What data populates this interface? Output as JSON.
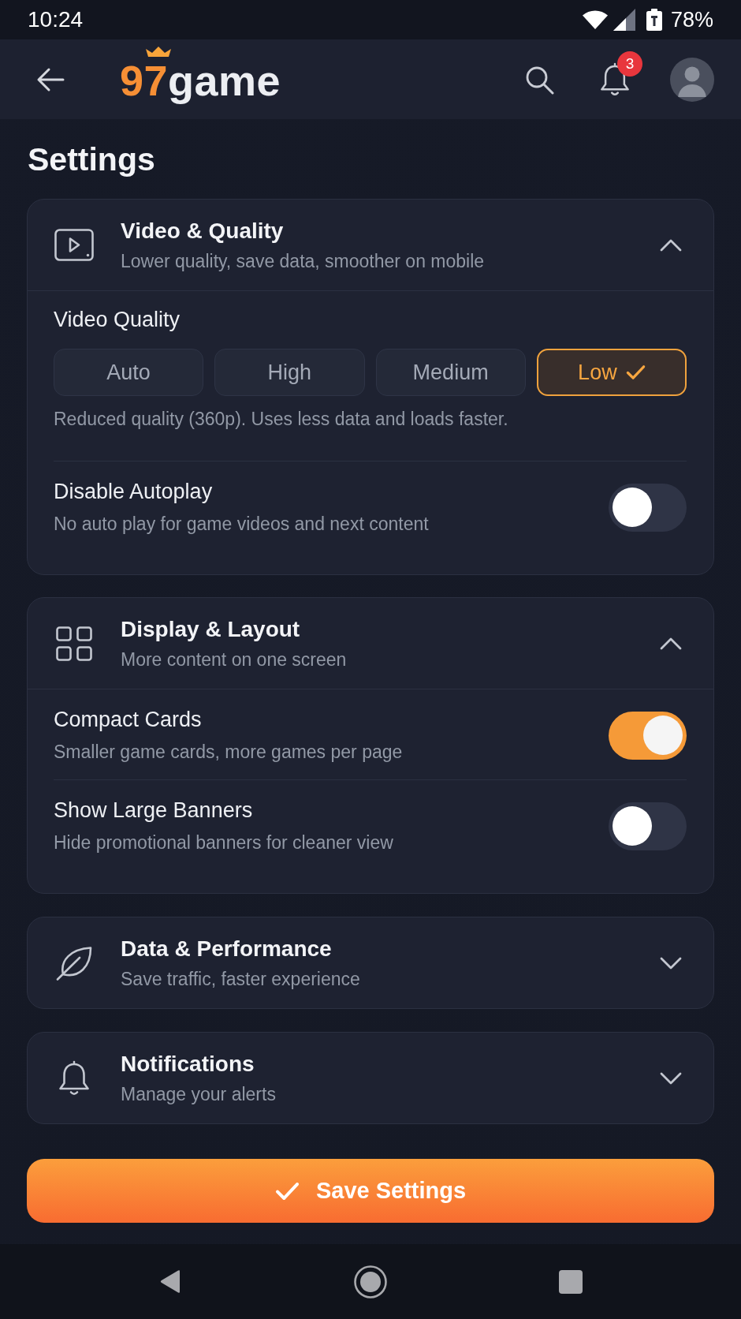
{
  "status_bar": {
    "time": "10:24",
    "battery": "78%"
  },
  "app_bar": {
    "logo": {
      "accent": "97",
      "text": "game"
    },
    "notification_count": "3"
  },
  "page_title": "Settings",
  "sections": [
    {
      "title": "Video & Quality",
      "subtitle": "Lower quality, save data, smoother on mobile",
      "expanded": true,
      "items": [
        {
          "kind": "choice",
          "label": "Video Quality",
          "options": [
            {
              "label": "Auto",
              "selected": false
            },
            {
              "label": "High",
              "selected": false
            },
            {
              "label": "Medium",
              "selected": false
            },
            {
              "label": "Low",
              "selected": true
            }
          ],
          "note": "Reduced quality (360p). Uses less data and loads faster."
        },
        {
          "kind": "toggle",
          "label": "Disable Autoplay",
          "description": "No auto play for game videos and next content",
          "on": false
        }
      ]
    },
    {
      "title": "Display & Layout",
      "subtitle": "More content on one screen",
      "expanded": true,
      "items": [
        {
          "kind": "toggle",
          "label": "Compact Cards",
          "description": "Smaller game cards, more games per page",
          "on": true
        },
        {
          "kind": "toggle",
          "label": "Show Large Banners",
          "description": "Hide promotional banners for cleaner view",
          "on": false
        }
      ]
    },
    {
      "title": "Data & Performance",
      "subtitle": "Save traffic, faster experience",
      "expanded": false
    },
    {
      "title": "Notifications",
      "subtitle": "Manage your alerts",
      "expanded": false
    }
  ],
  "save_button": {
    "label": "Save Settings"
  }
}
